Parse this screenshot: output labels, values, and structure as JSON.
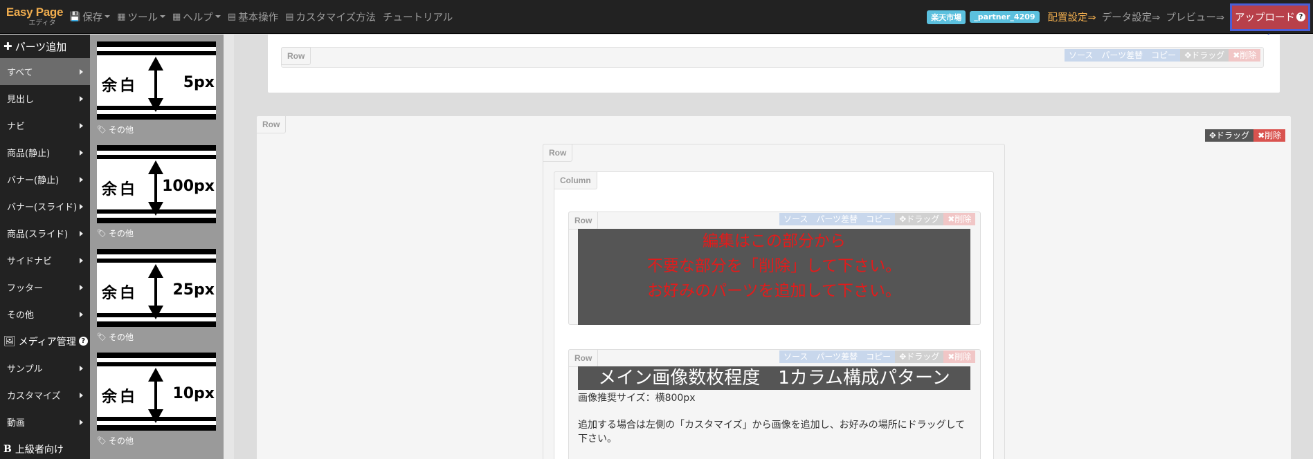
{
  "brand": {
    "title": "Easy Page",
    "subtitle": "エディタ"
  },
  "nav": {
    "save": "保存",
    "tools": "ツール",
    "help": "ヘルプ",
    "basic": "基本操作",
    "customize": "カスタマイズ方法",
    "tutorial": "チュートリアル"
  },
  "right_nav": {
    "badge1": "楽天市場",
    "badge2": "_partner_4209",
    "layout": "配置設定⇒",
    "data": "データ設定⇒",
    "preview": "プレビュー⇒",
    "upload": "アップロード",
    "help_mark": "?"
  },
  "sidebar": {
    "add_parts": "パーツ追加",
    "items": [
      {
        "label": "すべて"
      },
      {
        "label": "見出し"
      },
      {
        "label": "ナビ"
      },
      {
        "label": "商品(静止)"
      },
      {
        "label": "バナー(静止)"
      },
      {
        "label": "バナー(スライド)"
      },
      {
        "label": "商品(スライド)"
      },
      {
        "label": "サイドナビ"
      },
      {
        "label": "フッター"
      },
      {
        "label": "その他"
      }
    ],
    "media": "メディア管理",
    "media_help": "?",
    "items2": [
      {
        "label": "サンプル"
      },
      {
        "label": "カスタマイズ"
      },
      {
        "label": "動画"
      }
    ],
    "advanced": "上級者向け"
  },
  "thumbnails": [
    {
      "yohaku": "余白",
      "size": "5px",
      "tag": "その他"
    },
    {
      "yohaku": "余白",
      "size": "100px",
      "tag": "その他"
    },
    {
      "yohaku": "余白",
      "size": "25px",
      "tag": "その他"
    },
    {
      "yohaku": "余白",
      "size": "10px",
      "tag": "その他"
    }
  ],
  "canvas": {
    "row_label": "Row",
    "column_label": "Column",
    "toolbar": {
      "source": "ソース",
      "replace": "パーツ差替",
      "copy": "コピー",
      "drag": "✥ドラッグ",
      "delete": "✖削除"
    },
    "banner_lines": [
      "編集はこの部分から",
      "不要な部分を「削除」して下さい。",
      "お好みのパーツを追加して下さい。"
    ],
    "title_banner": "メイン画像数枚程度　1カラム構成パターン",
    "recommend": "画像推奨サイズ：横800px",
    "instruction": "追加する場合は左側の「カスタマイズ」から画像を追加し、お好みの場所にドラッグして下さい。"
  },
  "colors": {
    "navbar": "#222222",
    "brand": "#f0ad4e",
    "badge": "#5bc0de",
    "upload_bg": "#b8404a",
    "highlight": "#4a5fd6",
    "banner_text": "#e31b1b"
  }
}
